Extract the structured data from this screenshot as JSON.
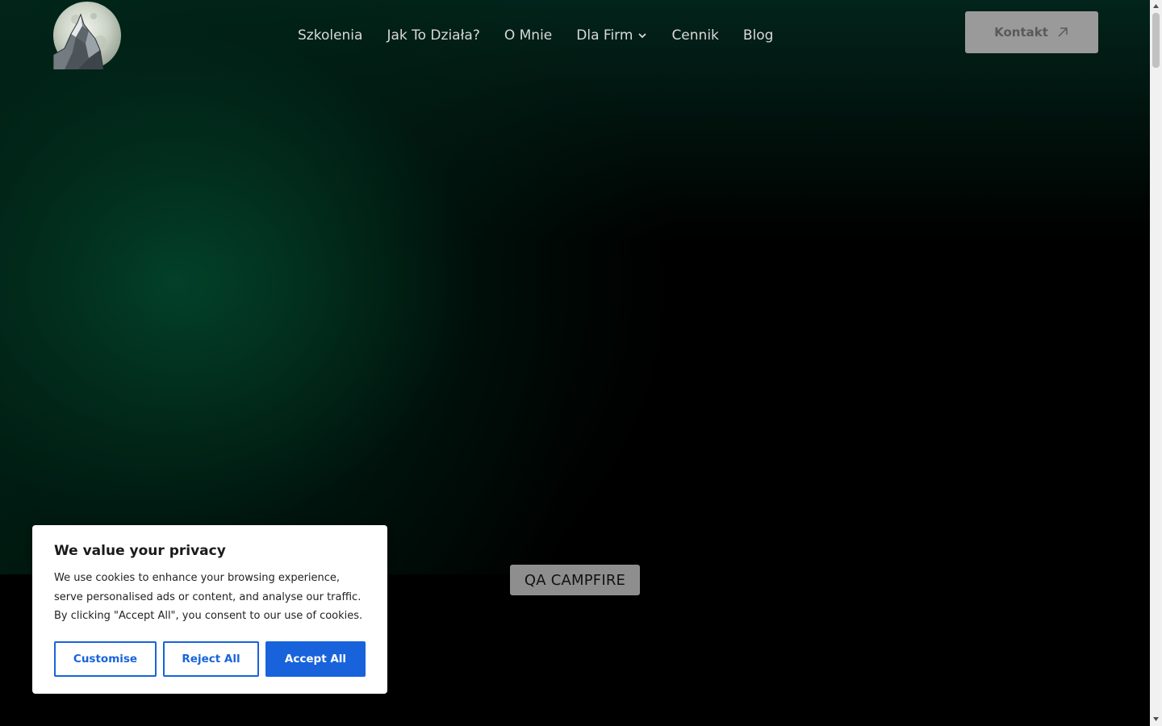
{
  "header": {
    "logo_alt": "Wolf and moon logo",
    "nav": [
      {
        "label": "Szkolenia"
      },
      {
        "label": "Jak To Działa?"
      },
      {
        "label": "O Mnie"
      },
      {
        "label": "Dla Firm",
        "has_dropdown": true
      },
      {
        "label": "Cennik"
      },
      {
        "label": "Blog"
      }
    ],
    "contact_label": "Kontakt",
    "contact_icon": "arrow-up-right-icon"
  },
  "hero": {
    "badge": "QA CAMPFIRE"
  },
  "cookie": {
    "title": "We value your privacy",
    "text": "We use cookies to enhance your browsing experience, serve personalised ads or content, and analyse our traffic. By clicking \"Accept All\", you consent to our use of cookies.",
    "customise": "Customise",
    "reject": "Reject All",
    "accept": "Accept All"
  },
  "colors": {
    "accent": "#1863dc",
    "hero_glow": "#025434"
  }
}
